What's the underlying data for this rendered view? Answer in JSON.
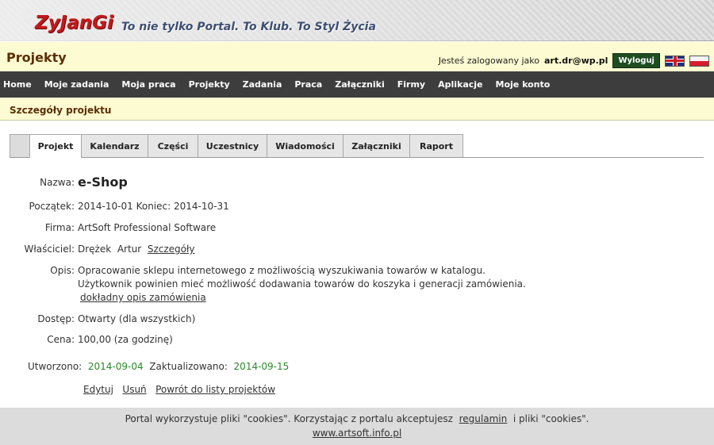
{
  "header": {
    "logo": "ZyJanGi",
    "slogan": "To nie tylko Portal. To Klub. To Styl Życia"
  },
  "titlebar": {
    "title": "Projekty",
    "logged_prefix": "Jesteś zalogowany jako",
    "user": "art.dr@wp.pl",
    "logout": "Wyloguj",
    "flags": [
      "flag-uk-icon",
      "flag-pl-icon"
    ]
  },
  "nav": {
    "items": [
      "Home",
      "Moje zadania",
      "Moja praca",
      "Projekty",
      "Zadania",
      "Praca",
      "Załączniki",
      "Firmy",
      "Aplikacje",
      "Moje konto"
    ]
  },
  "subtitle": "Szczegóły projektu",
  "tabs": [
    "Projekt",
    "Kalendarz",
    "Części",
    "Uczestnicy",
    "Wiadomości",
    "Załączniki",
    "Raport"
  ],
  "active_tab": "Projekt",
  "project": {
    "name_label": "Nazwa:",
    "name": "e-Shop",
    "start_label": "Początek:",
    "start": "2014-10-01",
    "end_label": "Koniec:",
    "end": "2014-10-31",
    "company_label": "Firma:",
    "company": "ArtSoft Professional Software",
    "owner_label": "Właściciel:",
    "owner_last": "Drężek",
    "owner_first": "Artur",
    "owner_details": "Szczegóły",
    "desc_label": "Opis:",
    "desc_line1": "Opracowanie sklepu internetowego z możliwością wyszukiwania towarów w katalogu.",
    "desc_line2": "Użytkownik powinien mieć możliwość dodawania towarów do koszyka i generacji zamówienia.",
    "desc_link": "dokładny opis zamówienia",
    "access_label": "Dostęp:",
    "access": "Otwarty (dla wszystkich)",
    "price_label": "Cena:",
    "price": "100,00 (za godzinę)",
    "created_label": "Utworzono:",
    "created": "2014-09-04",
    "updated_label": "Zaktualizowano:",
    "updated": "2014-09-15"
  },
  "actions": {
    "edit": "Edytuj",
    "delete": "Usuń",
    "back": "Powrót do listy projektów"
  },
  "footer": {
    "text_before": "Portal wykorzystuje pliki \"cookies\". Korzystając z portalu akceptujesz",
    "link": "regulamin",
    "text_after": "i pliki \"cookies\".",
    "url": "www.artsoft.info.pl"
  },
  "colors": {
    "logo": "#c2191c",
    "nav_bg": "#3d3d3d",
    "title_bg": "#fdfbd1",
    "logout_bg": "#1f4d22",
    "date_green": "#2a8a2a"
  }
}
